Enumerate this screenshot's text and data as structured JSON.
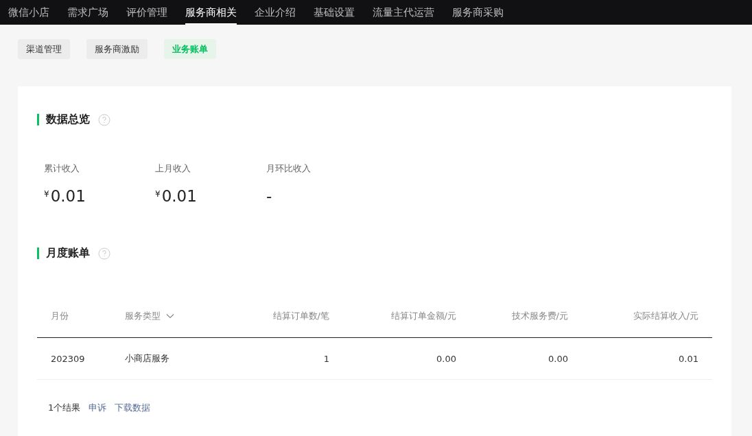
{
  "top_nav": [
    {
      "label": "微信小店",
      "selected": false
    },
    {
      "label": "需求广场",
      "selected": false
    },
    {
      "label": "评价管理",
      "selected": false
    },
    {
      "label": "服务商相关",
      "selected": true
    },
    {
      "label": "企业介绍",
      "selected": false
    },
    {
      "label": "基础设置",
      "selected": false
    },
    {
      "label": "流量主代运营",
      "selected": false
    },
    {
      "label": "服务商采购",
      "selected": false
    }
  ],
  "sub_tabs": [
    {
      "label": "渠道管理",
      "selected": false
    },
    {
      "label": "服务商激励",
      "selected": false
    },
    {
      "label": "业务账单",
      "selected": true
    }
  ],
  "overview": {
    "title": "数据总览",
    "stats": [
      {
        "label": "累计收入",
        "currency": "¥",
        "value": "0.01"
      },
      {
        "label": "上月收入",
        "currency": "¥",
        "value": "0.01"
      },
      {
        "label": "月环比收入",
        "value": "-"
      }
    ]
  },
  "monthly": {
    "title": "月度账单",
    "table": {
      "columns": [
        {
          "label": "月份",
          "sortable": false
        },
        {
          "label": "服务类型",
          "sortable": true
        },
        {
          "label": "结算订单数/笔",
          "sortable": false
        },
        {
          "label": "结算订单金额/元",
          "sortable": false
        },
        {
          "label": "技术服务费/元",
          "sortable": false
        },
        {
          "label": "实际结算收入/元",
          "sortable": false
        }
      ],
      "rows": [
        [
          "202309",
          "小商店服务",
          "1",
          "0.00",
          "0.00",
          "0.01"
        ]
      ]
    },
    "result_count": "1个结果",
    "links": [
      "申诉",
      "下载数据"
    ]
  }
}
